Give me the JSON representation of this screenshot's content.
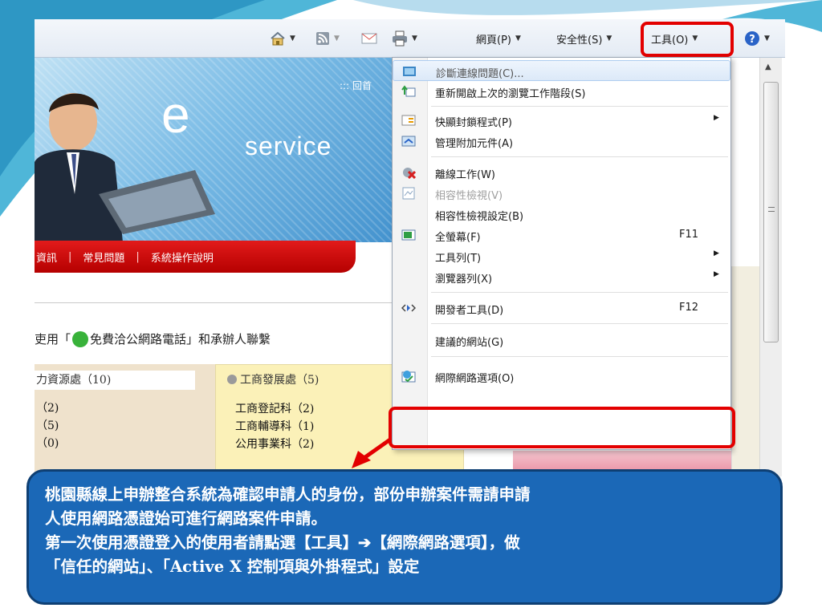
{
  "toolbar": {
    "page_menu": "網頁(P)",
    "safety_menu": "安全性(S)",
    "tools_menu": "工具(O)"
  },
  "website": {
    "banner_word_e": "e",
    "banner_word_service": "service",
    "home_link": "::: 回首",
    "nav": [
      "資訊",
      "常見問題",
      "系統操作說明"
    ],
    "notice_prefix": "吏用「",
    "notice_suffix": "免費洽公網路電話」和承辦人聯繫",
    "panel_left": {
      "title": "力資源處（10)",
      "rows": [
        "（2)",
        "（5)",
        "（0)"
      ]
    },
    "panel_right": {
      "title": "工商發展處（5)",
      "rows": [
        "工商登記科（2)",
        "工商輔導科（1)",
        "公用事業科（2)"
      ]
    }
  },
  "tools_dropdown": {
    "items": [
      {
        "label": "診斷連線問題(C)...",
        "shortcut": "",
        "submenu": false,
        "disabled": false,
        "icon": "diagnose-icon"
      },
      {
        "label": "重新開啟上次的瀏覽工作階段(S)",
        "shortcut": "",
        "submenu": false,
        "disabled": false,
        "icon": "reopen-session-icon"
      },
      {
        "label": "快顯封鎖程式(P)",
        "shortcut": "",
        "submenu": true,
        "disabled": false,
        "icon": "popup-blocker-icon"
      },
      {
        "label": "管理附加元件(A)",
        "shortcut": "",
        "submenu": false,
        "disabled": false,
        "icon": "addons-icon"
      },
      {
        "label": "離線工作(W)",
        "shortcut": "",
        "submenu": false,
        "disabled": false,
        "icon": "offline-icon"
      },
      {
        "label": "相容性檢視(V)",
        "shortcut": "",
        "submenu": false,
        "disabled": true,
        "icon": "compat-view-icon"
      },
      {
        "label": "相容性檢視設定(B)",
        "shortcut": "",
        "submenu": false,
        "disabled": false,
        "icon": ""
      },
      {
        "label": "全螢幕(F)",
        "shortcut": "F11",
        "submenu": false,
        "disabled": false,
        "icon": "fullscreen-icon"
      },
      {
        "label": "工具列(T)",
        "shortcut": "",
        "submenu": true,
        "disabled": false,
        "icon": ""
      },
      {
        "label": "瀏覽器列(X)",
        "shortcut": "",
        "submenu": true,
        "disabled": false,
        "icon": ""
      },
      {
        "label": "開發者工具(D)",
        "shortcut": "F12",
        "submenu": false,
        "disabled": false,
        "icon": "devtools-icon"
      },
      {
        "label": "建議的網站(G)",
        "shortcut": "",
        "submenu": false,
        "disabled": false,
        "icon": ""
      },
      {
        "label": "網際網路選項(O)",
        "shortcut": "",
        "submenu": false,
        "disabled": false,
        "icon": "internet-options-icon"
      }
    ]
  },
  "callout": {
    "lines": [
      "桃園縣線上申辦整合系統為確認申請人的身份，部份申辦案件需請申請",
      "人使用網路憑證始可進行網路案件申請。",
      "第一次使用憑證登入的使用者請點選【工具】➔【網際網路選項】，做",
      "「信任的網站」、「Active X  控制項與外掛程式」設定"
    ]
  },
  "colors": {
    "highlight_red": "#e30000",
    "callout_blue": "#1b68b7",
    "slide_teal": "#4fb6d8",
    "nav_red": "#d10d0d"
  }
}
